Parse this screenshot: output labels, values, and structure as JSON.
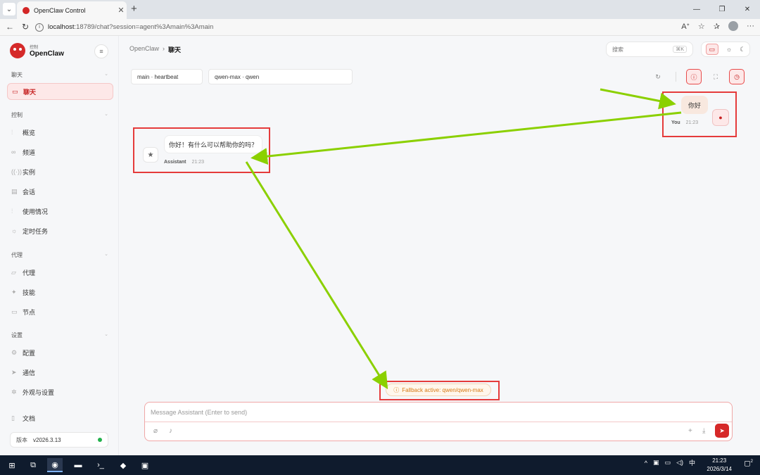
{
  "browser": {
    "tab_title": "OpenClaw Control",
    "tab_close": "✕",
    "new_tab": "+",
    "url_host": "localhost",
    "url_rest": ":18789/chat?session=agent%3Amain%3Amain"
  },
  "brand": {
    "sub": "控制",
    "name": "OpenClaw"
  },
  "sidebar": {
    "sections": [
      {
        "label": "聊天"
      },
      {
        "label": "控制"
      },
      {
        "label": "代理"
      },
      {
        "label": "设置"
      }
    ],
    "items": [
      {
        "label": "聊天",
        "icon": "chat-icon"
      },
      {
        "label": "概览",
        "icon": "chart-icon"
      },
      {
        "label": "频道",
        "icon": "link-icon"
      },
      {
        "label": "实例",
        "icon": "broadcast-icon"
      },
      {
        "label": "会话",
        "icon": "document-icon"
      },
      {
        "label": "使用情况",
        "icon": "bar-chart-icon"
      },
      {
        "label": "定时任务",
        "icon": "sun-icon"
      },
      {
        "label": "代理",
        "icon": "folder-icon"
      },
      {
        "label": "技能",
        "icon": "sparkle-icon"
      },
      {
        "label": "节点",
        "icon": "monitor-icon"
      },
      {
        "label": "配置",
        "icon": "gear-icon"
      },
      {
        "label": "通信",
        "icon": "send-icon"
      },
      {
        "label": "外观与设置",
        "icon": "settings-icon"
      },
      {
        "label": "文档",
        "icon": "book-icon"
      }
    ],
    "version_label": "版本",
    "version_value": "v2026.3.13"
  },
  "header": {
    "crumb_root": "OpenClaw",
    "crumb_sep": "›",
    "crumb_current": "聊天",
    "search_placeholder": "搜索",
    "search_kbd": "⌘K"
  },
  "toolbar": {
    "session_select": "main · heartbeat",
    "model_select": "qwen-max · qwen"
  },
  "messages": [
    {
      "role": "You",
      "text": "你好",
      "time": "21:23"
    },
    {
      "role": "Assistant",
      "text": "你好！有什么可以帮助你的吗？",
      "time": "21:23"
    }
  ],
  "fallback_text": "Fallback active: qwen/qwen-max",
  "composer": {
    "placeholder": "Message Assistant (Enter to send)"
  },
  "taskbar": {
    "time": "21:23",
    "date": "2026/3/14",
    "ime": "中",
    "notif_count": "2"
  },
  "colors": {
    "accent": "#d62828",
    "highlight": "#e53b3b",
    "annotation_arrow": "#8bd000",
    "fallback_text": "#d87a14"
  }
}
